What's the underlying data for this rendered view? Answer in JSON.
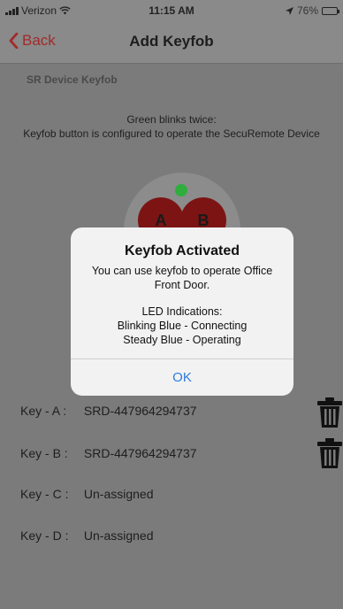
{
  "status_bar": {
    "carrier": "Verizon",
    "time": "11:15 AM",
    "battery": "76%",
    "battery_fraction": 0.76
  },
  "nav": {
    "back_label": "Back",
    "title": "Add Keyfob"
  },
  "content": {
    "section_title": "SR Device Keyfob",
    "info_line1": "Green blinks twice:",
    "info_line2": "Keyfob button is configured to operate the SecuRemote Device",
    "keyfob_buttons": [
      "A",
      "B"
    ]
  },
  "keys": [
    {
      "label": "Key - A :",
      "value": "SRD-447964294737"
    },
    {
      "label": "Key - B :",
      "value": "SRD-447964294737"
    },
    {
      "label": "Key - C :",
      "value": "Un-assigned"
    },
    {
      "label": "Key - D :",
      "value": "Un-assigned"
    }
  ],
  "alert": {
    "title": "Keyfob Activated",
    "message_line1": "You can use keyfob to operate Office",
    "message_line2": "Front Door.",
    "led_title": "LED Indications:",
    "led_line1": "Blinking Blue - Connecting",
    "led_line2": "Steady Blue - Operating",
    "ok_label": "OK"
  },
  "colors": {
    "accent_red": "#a22a2a",
    "led_green": "#2fae3e",
    "button_maroon": "#7c1414",
    "link_blue": "#2d7ae0"
  },
  "icons": [
    "wifi-icon",
    "location-arrow-icon",
    "battery-icon",
    "chevron-left-icon",
    "trash-icon"
  ]
}
